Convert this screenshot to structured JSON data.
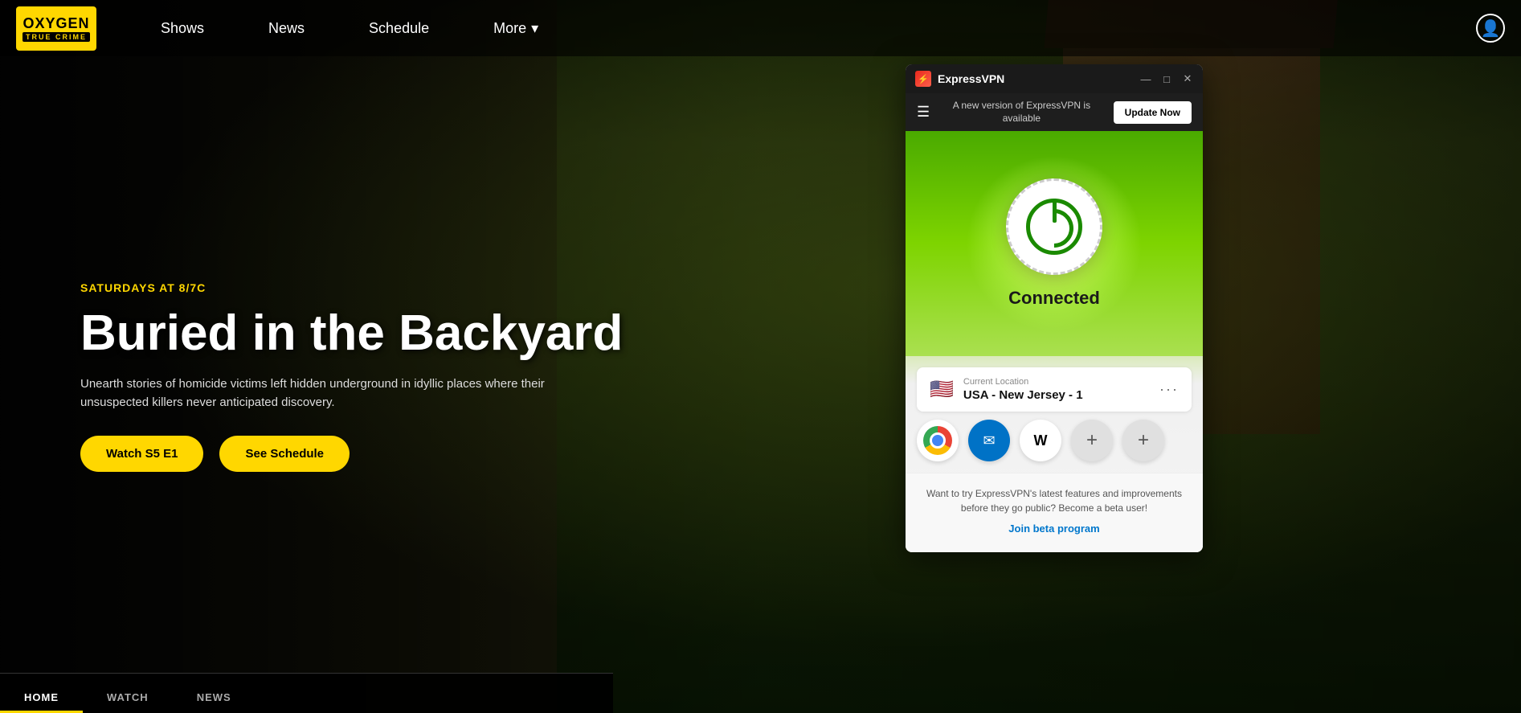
{
  "site": {
    "logo": {
      "line1": "OXYGEN",
      "line2": "TRUE CRIME"
    }
  },
  "nav": {
    "links": [
      {
        "id": "shows",
        "label": "Shows"
      },
      {
        "id": "news",
        "label": "News"
      },
      {
        "id": "schedule",
        "label": "Schedule"
      },
      {
        "id": "more",
        "label": "More",
        "hasArrow": true
      }
    ]
  },
  "hero": {
    "schedule": "SATURDAYS AT 8/7C",
    "title": "Buried in the Backyard",
    "description": "Unearth stories of homicide victims left hidden underground in idyllic places where their unsuspected killers never anticipated discovery.",
    "btn_watch": "Watch S5 E1",
    "btn_schedule": "See Schedule"
  },
  "bottom_tabs": [
    {
      "id": "home",
      "label": "HOME",
      "active": true
    },
    {
      "id": "watch",
      "label": "WATCH",
      "active": false
    },
    {
      "id": "news",
      "label": "NEWS",
      "active": false
    }
  ],
  "vpn": {
    "app_name": "ExpressVPN",
    "window_controls": {
      "minimize": "—",
      "maximize": "□",
      "close": "✕"
    },
    "update_bar": {
      "message": "A new version of ExpressVPN is available",
      "button_label": "Update Now"
    },
    "status": "Connected",
    "location": {
      "label": "Current Location",
      "name": "USA - New Jersey - 1",
      "flag": "🇺🇸"
    },
    "shortcuts": [
      {
        "id": "chrome",
        "type": "chrome"
      },
      {
        "id": "outlook",
        "label": "✉"
      },
      {
        "id": "wikipedia",
        "label": "W"
      },
      {
        "id": "add1",
        "label": "+"
      },
      {
        "id": "add2",
        "label": "+"
      }
    ],
    "beta": {
      "text": "Want to try ExpressVPN's latest features and improvements before they go public? Become a beta user!",
      "link_label": "Join beta program"
    }
  }
}
